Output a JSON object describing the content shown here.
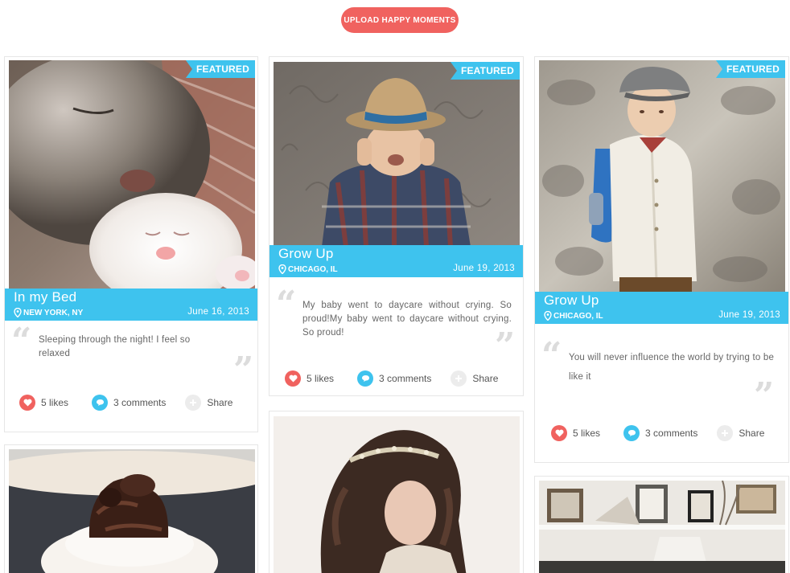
{
  "header": {
    "upload_label": "UPLOAD HAPPY MOMENTS"
  },
  "featured_label": "FEATURED",
  "colors": {
    "accent": "#3ec3ee",
    "like": "#f0625f",
    "upload": "#f0625f"
  },
  "cards": [
    {
      "title": "In my Bed",
      "location": "NEW YORK, NY",
      "date": "June 16, 2013",
      "quote": "Sleeping through the night! I feel so relaxed",
      "likes": "5 likes",
      "comments": "3 comments",
      "share": "Share",
      "photo": "kitten-photo"
    },
    {
      "title": "Grow Up",
      "location": "CHICAGO, IL",
      "date": "June 19, 2013",
      "quote": "My baby went to daycare without crying. So proud!My baby went to daycare without crying. So proud!",
      "likes": "5 likes",
      "comments": "3 comments",
      "share": "Share",
      "photo": "baby-hat-photo"
    },
    {
      "title": "Grow Up",
      "location": "CHICAGO, IL",
      "date": "June 19, 2013",
      "quote": "You will never influence the world by trying to be like it",
      "likes": "5 likes",
      "comments": "3 comments",
      "share": "Share",
      "photo": "boy-backpack-photo"
    }
  ],
  "more_photos": [
    "cupcake-photo",
    "bride-photo",
    "room-photo"
  ]
}
